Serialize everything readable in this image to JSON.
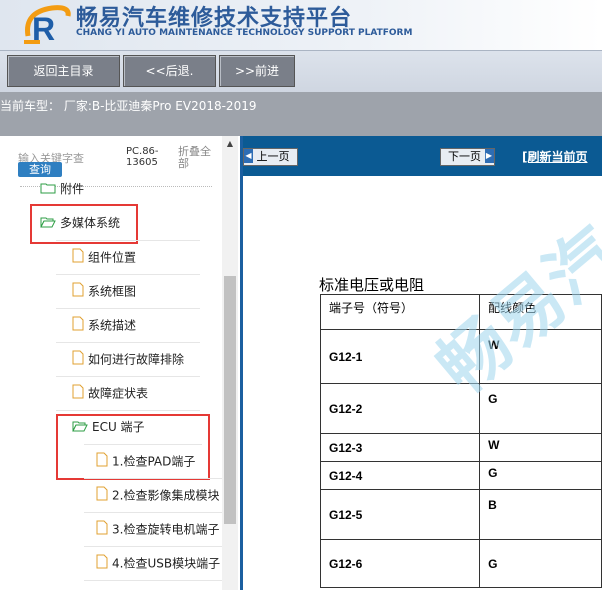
{
  "header": {
    "title_cn": "畅易汽车维修技术支持平台",
    "title_en": "CHANG YI AUTO MAINTENANCE TECHNOLOGY SUPPORT PLATFORM"
  },
  "toolbar": {
    "home_label": "返回主目录",
    "back_label": "<<后退.",
    "forward_label": ">>前进"
  },
  "car_info": "当前车型： 厂家:B-比亚迪秦Pro EV2018-2019",
  "search": {
    "placeholder": "输入关键字查",
    "button_label": "查询",
    "pc_code_line1": "PC.86-",
    "pc_code_line2": "13605",
    "collapse_line1": "折叠全",
    "collapse_line2": "部"
  },
  "tree": {
    "partial_item": "附件",
    "multimedia": "多媒体系统",
    "components": "组件位置",
    "diagram": "系统框图",
    "description": "系统描述",
    "howto": "如何进行故障排除",
    "symptoms": "故障症状表",
    "ecu_terminal": "ECU 端子",
    "check_pad": "1.检查PAD端子",
    "check_video": "2.检查影像集成模块",
    "check_rotate": "3.检查旋转电机端子",
    "check_usb": "4.检查USB模块端子"
  },
  "pager": {
    "prev_label": "上一页",
    "next_label": "下一页",
    "refresh_label": "[刷新当前页"
  },
  "content": {
    "section_title": "标准电压或电阻",
    "col_terminal": "端子号（符号）",
    "col_wire": "配线颜色",
    "rows": [
      {
        "terminal": "G12-1",
        "color": "W"
      },
      {
        "terminal": "G12-2",
        "color": "G"
      },
      {
        "terminal": "G12-3",
        "color": "W"
      },
      {
        "terminal": "G12-4",
        "color": "G"
      },
      {
        "terminal": "G12-5",
        "color": "B"
      },
      {
        "terminal": "G12-6",
        "color": "G"
      }
    ],
    "watermark": "畅易汽"
  },
  "colors": {
    "brand_blue": "#2d5b9a",
    "pane_header": "#0b5a93",
    "highlight_red": "#e53935"
  }
}
